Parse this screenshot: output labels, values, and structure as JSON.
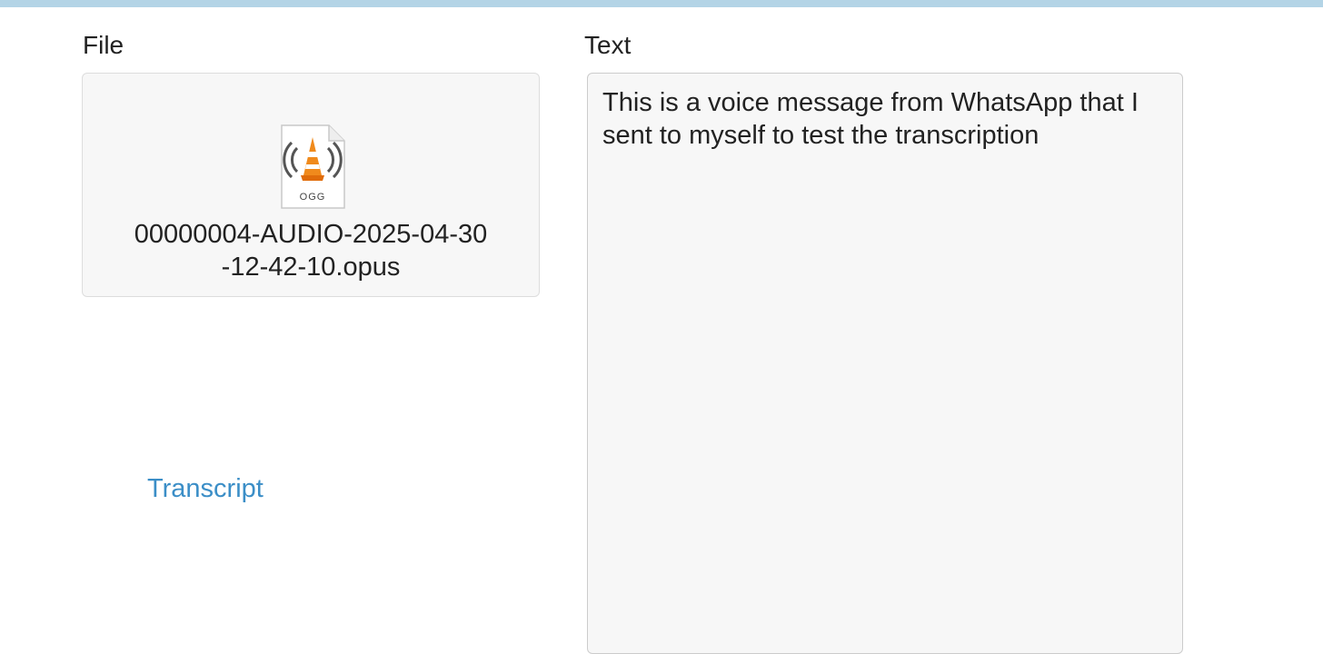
{
  "labels": {
    "file": "File",
    "text": "Text"
  },
  "file": {
    "name": "00000004-AUDIO-2025-04-30-12-42-10.opus",
    "name_line1": "00000004-AUDIO-2025-04-30",
    "name_line2": "-12-42-10.opus",
    "icon": "vlc-ogg-file-icon",
    "icon_badge": "OGG"
  },
  "transcript_link": "Transcript",
  "text_content": "This is a voice message from WhatsApp that I sent to myself to test the transcription",
  "colors": {
    "top_bar": "#b3d4e6",
    "link": "#3b8ec7",
    "panel_bg": "#f7f7f7"
  }
}
